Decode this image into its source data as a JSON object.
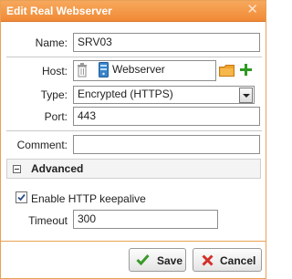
{
  "dialog": {
    "title": "Edit Real Webserver",
    "close_label": "✕"
  },
  "name": {
    "label": "Name:",
    "value": "SRV03"
  },
  "host": {
    "label": "Host:",
    "value": "Webserver"
  },
  "type": {
    "label": "Type:",
    "value": "Encrypted (HTTPS)"
  },
  "port": {
    "label": "Port:",
    "value": "443"
  },
  "comment": {
    "label": "Comment:",
    "value": ""
  },
  "advanced": {
    "title": "Advanced",
    "keepalive_label": "Enable HTTP keepalive",
    "keepalive_checked": true,
    "timeout_label": "Timeout",
    "timeout_value": "300"
  },
  "buttons": {
    "save": "Save",
    "cancel": "Cancel"
  },
  "colors": {
    "title_bar": "#f08a36",
    "save_check": "#3a9a2a",
    "cancel_x": "#d2302a",
    "folder": "#f0a030",
    "add_plus": "#2e9a22"
  },
  "icons": [
    "close-icon",
    "trash-icon",
    "server-icon",
    "folder-icon",
    "plus-icon",
    "collapse-icon",
    "checkmark-icon",
    "cross-icon"
  ]
}
